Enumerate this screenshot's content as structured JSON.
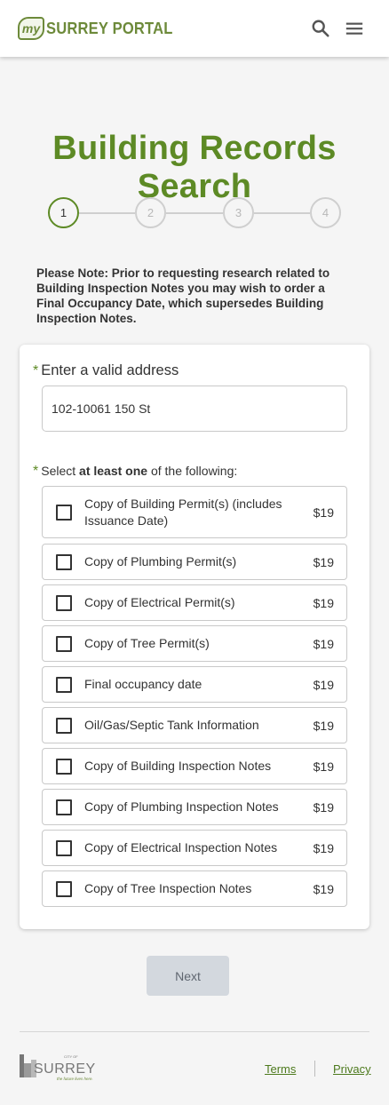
{
  "header": {
    "logo_my": "my",
    "logo_text": "SURREY PORTAL",
    "search_icon": "search-icon",
    "menu_icon": "hamburger-menu-icon"
  },
  "page": {
    "title": "Building Records Search"
  },
  "stepper": {
    "steps": [
      "1",
      "2",
      "3",
      "4"
    ],
    "current": 1
  },
  "note": "Please Note: Prior to requesting research related to Building Inspection Notes you may wish to order a Final Occupancy Date, which supersedes Building Inspection Notes.",
  "form": {
    "required_marker": "*",
    "address_label": "Enter a valid address",
    "address_value": "102-10061 150 St",
    "select_prefix": "Select ",
    "select_bold": "at least one",
    "select_suffix": " of the following:",
    "options": [
      {
        "label": "Copy of Building Permit(s) (includes Issuance Date)",
        "price": "$19",
        "checked": false
      },
      {
        "label": "Copy of Plumbing Permit(s)",
        "price": "$19",
        "checked": false
      },
      {
        "label": "Copy of Electrical Permit(s)",
        "price": "$19",
        "checked": false
      },
      {
        "label": "Copy of Tree Permit(s)",
        "price": "$19",
        "checked": false
      },
      {
        "label": "Final occupancy date",
        "price": "$19",
        "checked": false
      },
      {
        "label": "Oil/Gas/Septic Tank Information",
        "price": "$19",
        "checked": false
      },
      {
        "label": "Copy of Building Inspection Notes",
        "price": "$19",
        "checked": false
      },
      {
        "label": "Copy of Plumbing Inspection Notes",
        "price": "$19",
        "checked": false
      },
      {
        "label": "Copy of Electrical Inspection Notes",
        "price": "$19",
        "checked": false
      },
      {
        "label": "Copy of Tree Inspection Notes",
        "price": "$19",
        "checked": false
      }
    ]
  },
  "actions": {
    "next_label": "Next"
  },
  "footer": {
    "logo_small": "CITY OF",
    "logo_name": "SURREY",
    "logo_tagline": "the future lives here.",
    "terms_label": "Terms",
    "privacy_label": "Privacy"
  },
  "colors": {
    "brand_green": "#5d8a25",
    "button_disabled": "#d3d8de"
  }
}
